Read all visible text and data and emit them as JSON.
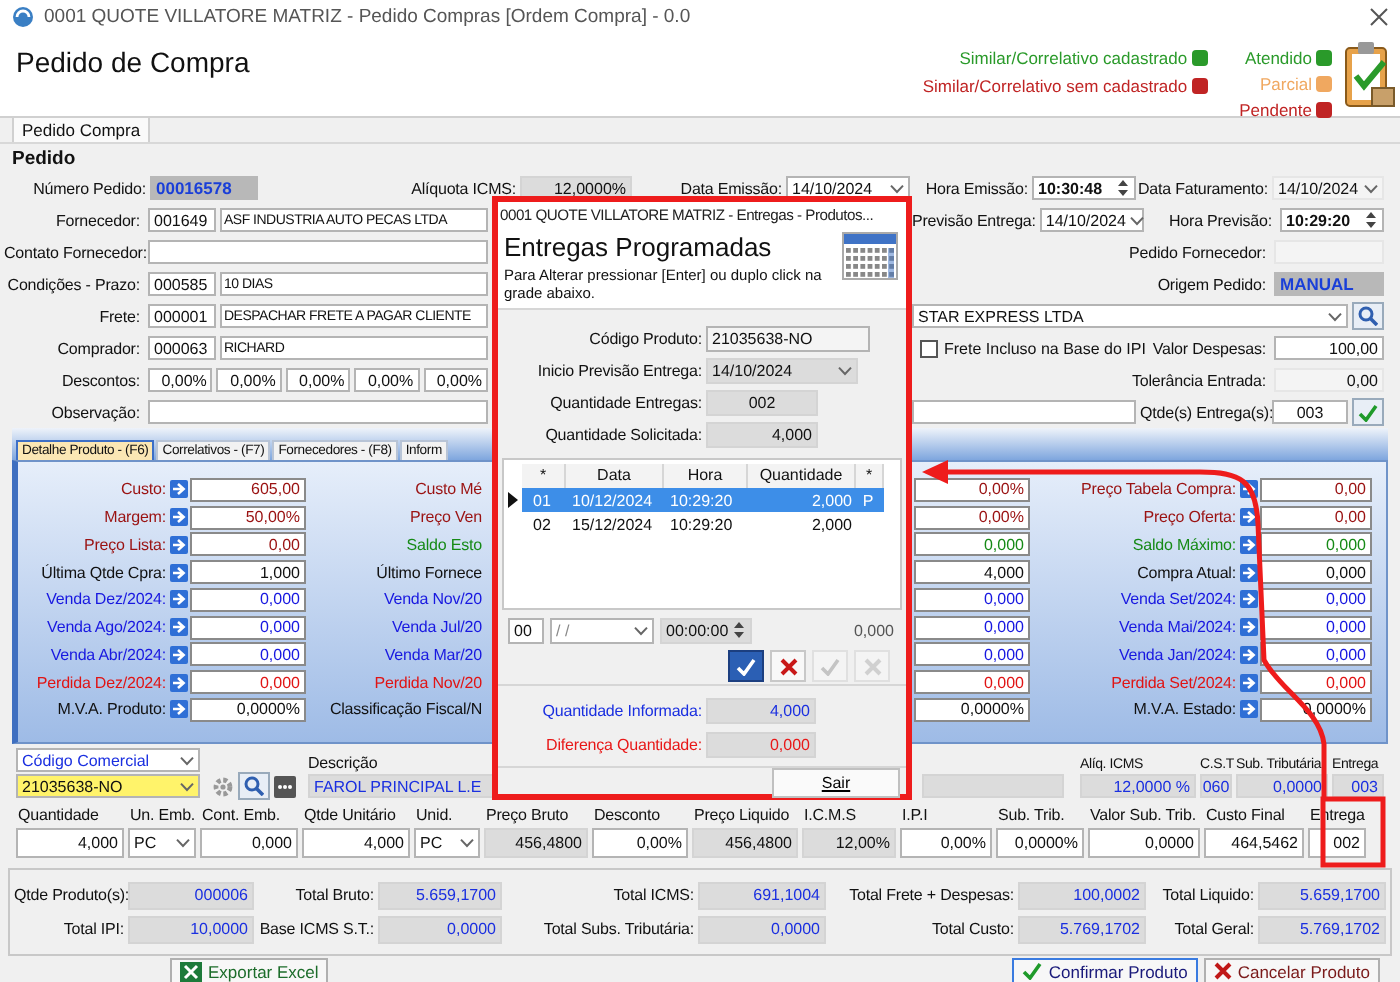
{
  "window": {
    "title": "0001 QUOTE VILLATORE MATRIZ - Pedido Compras [Ordem Compra] - 0.0"
  },
  "header": {
    "title": "Pedido de Compra",
    "legend": [
      {
        "label": "Similar/Correlativo cadastrado",
        "color": "#2a9a2a"
      },
      {
        "label": "Similar/Correlativo sem cadastrado",
        "color": "#c02424"
      }
    ],
    "status": [
      {
        "label": "Atendido",
        "color": "#2a9a2a"
      },
      {
        "label": "Parcial",
        "color": "#f0a860"
      },
      {
        "label": "Pendente",
        "color": "#c02424"
      }
    ]
  },
  "form_tabs": [
    {
      "label": "Pedido Compra",
      "selected": true
    }
  ],
  "pedido": {
    "title": "Pedido",
    "numero_pedido": {
      "label": "Número Pedido:",
      "value": "00016578"
    },
    "aliquota_icms": {
      "label": "Alíquota ICMS:",
      "value": "12,0000%"
    },
    "data_emissao": {
      "label": "Data Emissão:",
      "value": "14/10/2024"
    },
    "hora_emissao": {
      "label": "Hora Emissão:",
      "value": "10:30:48"
    },
    "data_faturamento": {
      "label": "Data Faturamento:",
      "value": "14/10/2024"
    },
    "fornecedor": {
      "label": "Fornecedor:",
      "code": "001649",
      "name": "ASF INDUSTRIA AUTO PECAS LTDA"
    },
    "contato_fornecedor": {
      "label": "Contato Fornecedor:"
    },
    "condicoes_prazo": {
      "label": "Condições - Prazo:",
      "code": "000585",
      "name": "10 DIAS"
    },
    "frete": {
      "label": "Frete:",
      "code": "000001",
      "name": "DESPACHAR FRETE A PAGAR CLIENTE"
    },
    "comprador": {
      "label": "Comprador:",
      "code": "000063",
      "name": "RICHARD"
    },
    "descontos": {
      "label": "Descontos:",
      "values": [
        "0,00%",
        "0,00%",
        "0,00%",
        "0,00%",
        "0,00%"
      ]
    },
    "observacao": {
      "label": "Observação:"
    },
    "previsao_entrega": {
      "label": "Previsão Entrega:",
      "value": "14/10/2024"
    },
    "hora_previsao": {
      "label": "Hora Previsão:",
      "value": "10:29:20"
    },
    "pedido_fornecedor": {
      "label": "Pedido Fornecedor:"
    },
    "origem_pedido": {
      "label": "Origem Pedido:",
      "value": "MANUAL"
    },
    "transportadora": {
      "value": "STAR EXPRESS LTDA"
    },
    "frete_incluso": {
      "label": "Frete Incluso na Base do IPI",
      "checked": false
    },
    "valor_despesas": {
      "label": "Valor Despesas:",
      "value": "100,00"
    },
    "tolerancia_entrada": {
      "label": "Tolerância Entrada:",
      "value": "0,00"
    },
    "qtde_entregas": {
      "label": "Qtde(s) Entrega(s):",
      "value": "003"
    }
  },
  "detail_tabs": [
    {
      "label": "Detalhe Produto - (F6)",
      "selected": true
    },
    {
      "label": "Correlativos - (F7)",
      "selected": false
    },
    {
      "label": "Fornecedores - (F8)",
      "selected": false
    },
    {
      "label": "Inform",
      "selected": false
    }
  ],
  "detail_rows": [
    {
      "left": {
        "label": "Custo:",
        "value": "605,00",
        "kind": "price"
      },
      "middle": {
        "label": "Custo Mé",
        "value": "0,00%",
        "kind": "price"
      },
      "right": {
        "label": "Preço Tabela Compra:",
        "value": "0,00",
        "kind": "price"
      }
    },
    {
      "left": {
        "label": "Margem:",
        "value": "50,00%",
        "kind": "price"
      },
      "middle": {
        "label": "Preço Ven",
        "value": "0,00%",
        "kind": "price"
      },
      "right": {
        "label": "Preço Oferta:",
        "value": "0,00",
        "kind": "price"
      }
    },
    {
      "left": {
        "label": "Preço Lista:",
        "value": "0,00",
        "kind": "price"
      },
      "middle": {
        "label": "Saldo Esto",
        "value": "0,000",
        "kind": "stock"
      },
      "right": {
        "label": "Saldo Máximo:",
        "value": "0,000",
        "kind": "stock"
      }
    },
    {
      "left": {
        "label": "Última Qtde Cpra:",
        "value": "1,000",
        "kind": "plain"
      },
      "middle": {
        "label": "Último Fornece",
        "value": "4,000",
        "kind": "plain"
      },
      "right": {
        "label": "Compra Atual:",
        "value": "0,000",
        "kind": "plain"
      }
    },
    {
      "left": {
        "label": "Venda Dez/2024:",
        "value": "0,000",
        "kind": "sale"
      },
      "middle": {
        "label": "Venda Nov/20",
        "value": "0,000",
        "kind": "sale"
      },
      "right": {
        "label": "Venda Set/2024:",
        "value": "0,000",
        "kind": "sale"
      }
    },
    {
      "left": {
        "label": "Venda Ago/2024:",
        "value": "0,000",
        "kind": "sale"
      },
      "middle": {
        "label": "Venda Jul/20",
        "value": "0,000",
        "kind": "sale"
      },
      "right": {
        "label": "Venda Mai/2024:",
        "value": "0,000",
        "kind": "sale"
      }
    },
    {
      "left": {
        "label": "Venda Abr/2024:",
        "value": "0,000",
        "kind": "sale"
      },
      "middle": {
        "label": "Venda Mar/20",
        "value": "0,000",
        "kind": "sale"
      },
      "right": {
        "label": "Venda Jan/2024:",
        "value": "0,000",
        "kind": "sale"
      }
    },
    {
      "left": {
        "label": "Perdida Dez/2024:",
        "value": "0,000",
        "kind": "loss"
      },
      "middle": {
        "label": "Perdida Nov/20",
        "value": "0,000",
        "kind": "loss"
      },
      "right": {
        "label": "Perdida Set/2024:",
        "value": "0,000",
        "kind": "loss"
      }
    },
    {
      "left": {
        "label": "M.V.A. Produto:",
        "value": "0,0000%",
        "kind": "plain"
      },
      "middle": {
        "label": "Classificação Fiscal/N",
        "value": "0,0000%",
        "kind": "plain"
      },
      "right": {
        "label": "M.V.A. Estado:",
        "value": "0,0000%",
        "kind": "plain"
      }
    }
  ],
  "produto": {
    "search_mode": "Código Comercial",
    "code": "21035638-NO",
    "descricao_label": "Descrição",
    "descricao": "FAROL PRINCIPAL L.E",
    "tax": [
      {
        "label": "Alíq. ICMS",
        "value": "12,0000 %"
      },
      {
        "label": "C.S.T",
        "value": "060"
      },
      {
        "label": "Sub. Tributária",
        "value": "0,0000"
      },
      {
        "label": "Entrega",
        "value": "003"
      }
    ],
    "line": [
      {
        "label": "Quantidade",
        "value": "4,000",
        "kind": "input"
      },
      {
        "label": "Un. Emb.",
        "value": "PC",
        "kind": "combo"
      },
      {
        "label": "Cont. Emb.",
        "value": "0,000",
        "kind": "input"
      },
      {
        "label": "Qtde Unitário",
        "value": "4,000",
        "kind": "input"
      },
      {
        "label": "Unid.",
        "value": "PC",
        "kind": "combo"
      },
      {
        "label": "Preço Bruto",
        "value": "456,4800",
        "kind": "readonly"
      },
      {
        "label": "Desconto",
        "value": "0,00%",
        "kind": "input"
      },
      {
        "label": "Preço Liquido",
        "value": "456,4800",
        "kind": "readonly"
      },
      {
        "label": "I.C.M.S",
        "value": "12,00%",
        "kind": "readonly"
      },
      {
        "label": "I.P.I",
        "value": "0,00%",
        "kind": "input"
      },
      {
        "label": "Sub. Trib.",
        "value": "0,0000%",
        "kind": "input"
      },
      {
        "label": "Valor Sub. Trib.",
        "value": "0,0000",
        "kind": "input"
      },
      {
        "label": "Custo Final",
        "value": "464,5462",
        "kind": "input"
      },
      {
        "label": "Entrega",
        "value": "002",
        "kind": "input"
      }
    ]
  },
  "totals": [
    [
      {
        "label": "Qtde Produto(s):",
        "value": "000006"
      },
      {
        "label": "Total Bruto:",
        "value": "5.659,1700"
      },
      {
        "label": "Total ICMS:",
        "value": "691,1004"
      },
      {
        "label": "Total Frete + Despesas:",
        "value": "100,0002"
      },
      {
        "label": "Total Liquido:",
        "value": "5.659,1700"
      }
    ],
    [
      {
        "label": "Total IPI:",
        "value": "10,0000"
      },
      {
        "label": "Base ICMS S.T.:",
        "value": "0,0000"
      },
      {
        "label": "Total Subs. Tributária:",
        "value": "0,0000"
      },
      {
        "label": "Total Custo:",
        "value": "5.769,1702"
      },
      {
        "label": "Total Geral:",
        "value": "5.769,1702"
      }
    ]
  ],
  "footer_buttons": [
    {
      "label": "Exportar Excel",
      "kind": "excel"
    },
    {
      "label": "Confirmar Produto",
      "kind": "confirm"
    },
    {
      "label": "Cancelar Produto",
      "kind": "cancel"
    }
  ],
  "dialog": {
    "title": "0001 QUOTE VILLATORE MATRIZ - Entregas - Produtos...",
    "heading": "Entregas Programadas",
    "hint": "Para Alterar pressionar [Enter] ou duplo click na grade abaixo.",
    "fields": [
      {
        "label": "Código Produto:",
        "value": "21035638-NO",
        "kind": "text"
      },
      {
        "label": "Inicio Previsão Entrega:",
        "value": "14/10/2024",
        "kind": "date"
      },
      {
        "label": "Quantidade Entregas:",
        "value": "002",
        "kind": "count"
      },
      {
        "label": "Quantidade Solicitada:",
        "value": "4,000",
        "kind": "number"
      }
    ],
    "grid": {
      "columns": [
        "*",
        "Data",
        "Hora",
        "Quantidade",
        "*"
      ],
      "rows": [
        {
          "cells": [
            "01",
            "10/12/2024",
            "10:29:20",
            "2,000",
            "P"
          ],
          "selected": true
        },
        {
          "cells": [
            "02",
            "15/12/2024",
            "10:29:20",
            "2,000"
          ],
          "selected": false
        }
      ]
    },
    "editor": {
      "number": "00",
      "date": "/ /",
      "time": "00:00:00",
      "quantity": "0,000"
    },
    "actions": [
      {
        "kind": "confirm",
        "disabled": false
      },
      {
        "kind": "cancel",
        "disabled": false
      },
      {
        "kind": "confirm",
        "disabled": true
      },
      {
        "kind": "cancel",
        "disabled": true
      }
    ],
    "summary": [
      {
        "label": "Quantidade Informada:",
        "value": "4,000",
        "kind": "info"
      },
      {
        "label": "Diferença Quantidade:",
        "value": "0,000",
        "kind": "diff"
      }
    ],
    "exit_button": "Sair"
  }
}
